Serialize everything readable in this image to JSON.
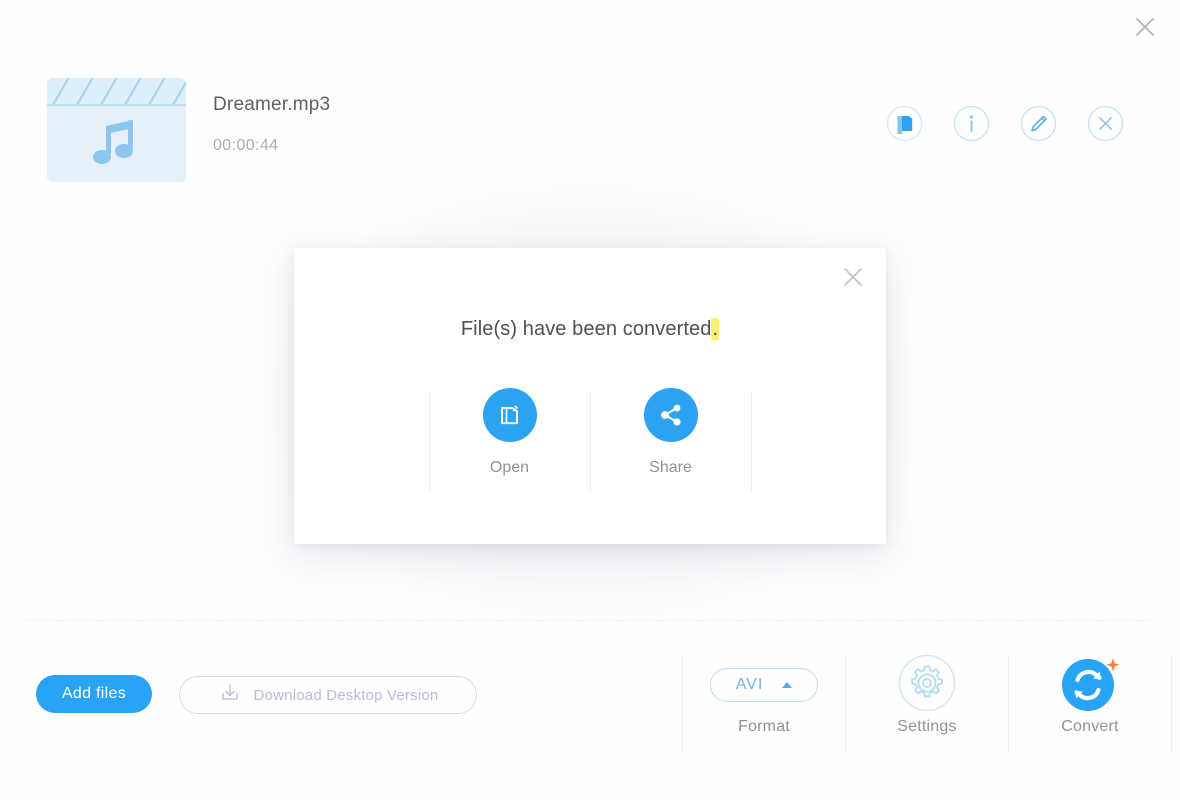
{
  "window": {
    "close_icon": "close-icon"
  },
  "file": {
    "name": "Dreamer.mp3",
    "duration": "00:00:44",
    "thumb_icon": "music-clapperboard-thumbnail",
    "actions": [
      {
        "id": "open-folder",
        "icon": "folder-icon"
      },
      {
        "id": "info",
        "icon": "info-icon"
      },
      {
        "id": "edit",
        "icon": "pencil-icon"
      },
      {
        "id": "remove",
        "icon": "close-circle-icon"
      }
    ]
  },
  "modal": {
    "title_text": "File(s) have been converted",
    "title_highlight": ".",
    "close_icon": "close-icon",
    "actions": [
      {
        "label": "Open",
        "icon": "open-folder-icon"
      },
      {
        "label": "Share",
        "icon": "share-icon"
      }
    ]
  },
  "toolbar": {
    "add_files_label": "Add files",
    "download_label": "Download Desktop Version",
    "download_icon": "download-icon",
    "format": {
      "label": "Format",
      "value": "AVI",
      "caret_icon": "chevron-up-icon"
    },
    "settings": {
      "label": "Settings",
      "icon": "gear-icon"
    },
    "convert": {
      "label": "Convert",
      "icon": "convert-arrows-icon",
      "badge_icon": "sparkle-icon"
    }
  },
  "colors": {
    "accent_blue": "#29a3f5",
    "light_blue": "#bedcf5",
    "thumb_bg": "#e4f1fb",
    "highlight_yellow": "#fcef6a",
    "lavender": "#b9b9e0",
    "orange": "#f2803c",
    "text_dark": "#5d6166",
    "text_muted": "#8e9398"
  }
}
